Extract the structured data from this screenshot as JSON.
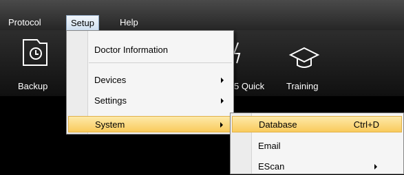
{
  "menubar": {
    "items": [
      {
        "label": "Protocol"
      },
      {
        "label": "Setup"
      },
      {
        "label": "Help"
      }
    ]
  },
  "toolbar": {
    "buttons": [
      {
        "label": "Backup",
        "icon": "backup-icon"
      },
      {
        "label": "5 Quick",
        "icon": "lightning-icon"
      },
      {
        "label": "Training",
        "icon": "graduation-cap-icon"
      }
    ]
  },
  "setup_menu": {
    "items": [
      {
        "label": "Doctor Information"
      },
      {
        "label": "Devices"
      },
      {
        "label": "Settings"
      },
      {
        "label": "System"
      }
    ]
  },
  "system_submenu": {
    "items": [
      {
        "label": "Database",
        "shortcut": "Ctrl+D"
      },
      {
        "label": "Email"
      },
      {
        "label": "EScan"
      }
    ]
  },
  "colors": {
    "menubar_bg": "#2f2f2f",
    "highlight": "#f9cb5c",
    "menu_bg": "#f5f5f5"
  }
}
